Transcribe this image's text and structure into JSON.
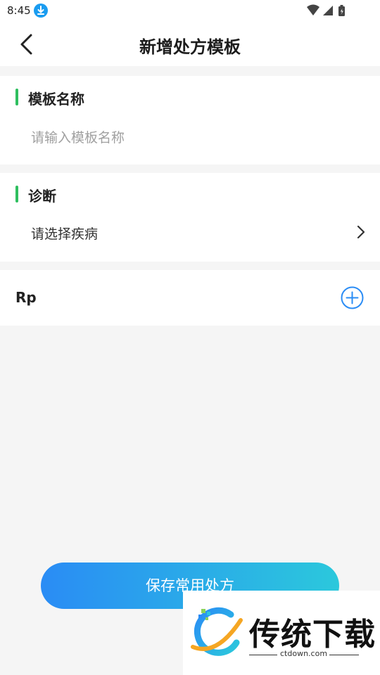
{
  "status_bar": {
    "time": "8:45",
    "icons": [
      "download-icon",
      "wifi-icon",
      "signal-icon",
      "battery-icon"
    ]
  },
  "header": {
    "title": "新增处方模板",
    "back_icon": "back-arrow-icon"
  },
  "template_name": {
    "label": "模板名称",
    "placeholder": "请输入模板名称",
    "value": ""
  },
  "diagnosis": {
    "label": "诊断",
    "select_text": "请选择疾病"
  },
  "rp": {
    "label": "Rp",
    "add_icon": "add-circle-icon"
  },
  "footer": {
    "save_label": "保存常用处方"
  },
  "watermark": {
    "brand": "传统下载",
    "domain": "ctdown.com"
  },
  "colors": {
    "accent_green": "#2fbf5f",
    "primary_blue": "#2a8cf5",
    "gradient_end": "#2bc8dc",
    "background": "#f5f5f5"
  }
}
